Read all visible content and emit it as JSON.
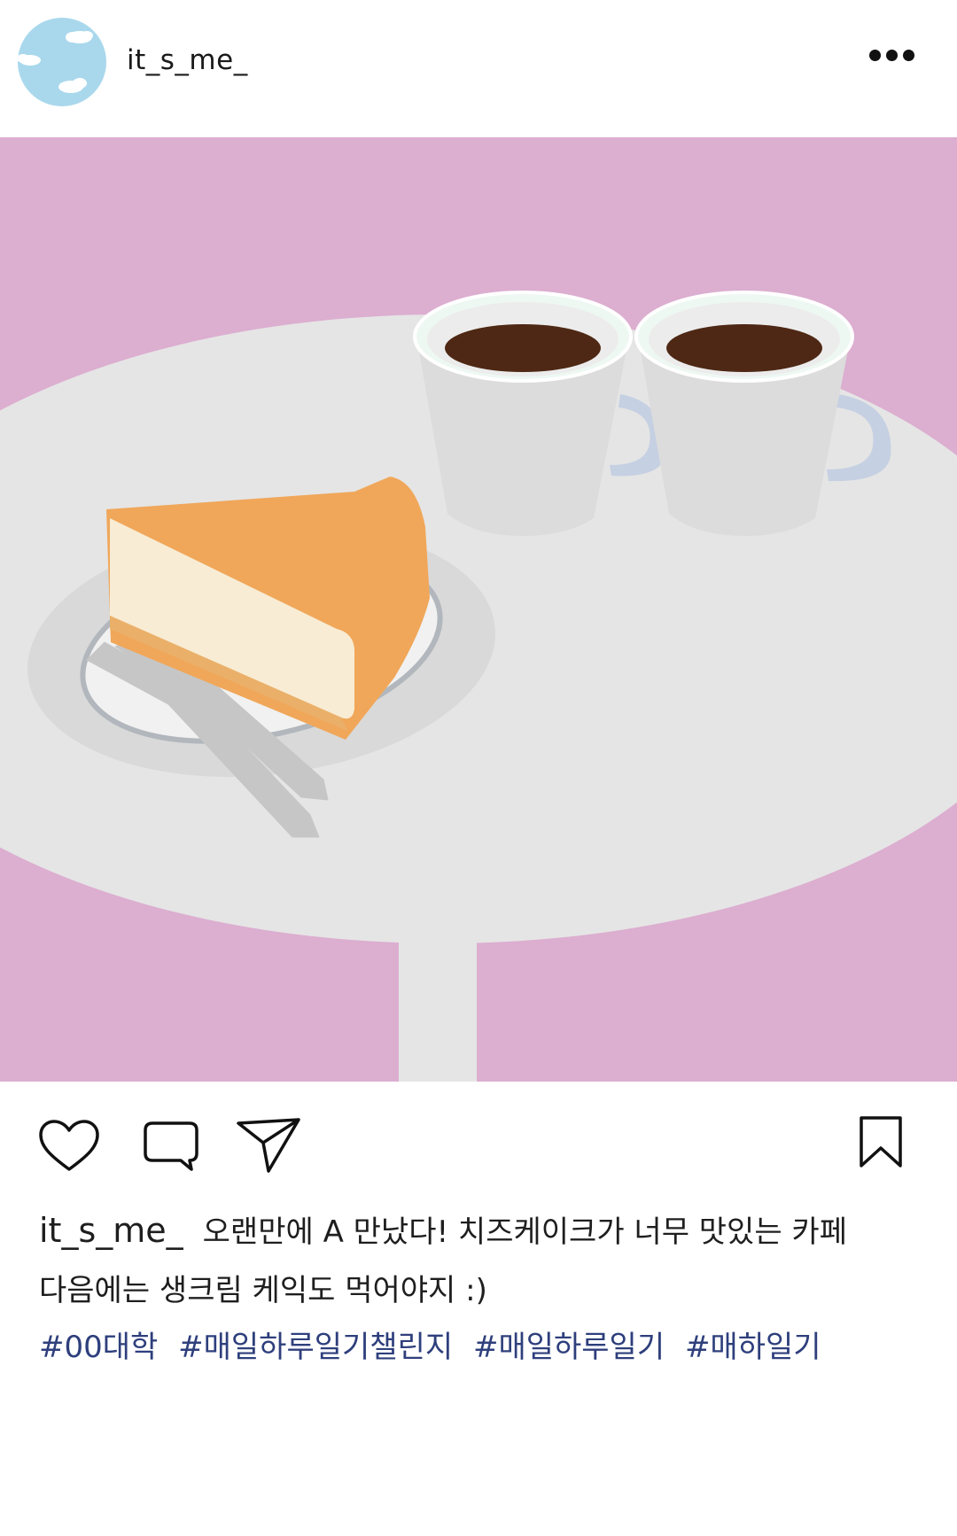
{
  "post": {
    "username": "it_s_me_",
    "caption_username": "it_s_me_",
    "caption_line1": "오랜만에 A 만났다! 치즈케이크가 너무 맛있는 카페",
    "caption_line2": "다음에는 생크림 케익도 먹어야지 :)",
    "hashtags": [
      "#00대학",
      "#매일하루일기챌린지",
      "#매일하루일기",
      "#매하일기"
    ]
  },
  "icons": {
    "avatar": "sky-cloud-avatar",
    "more": "more-dots-icon",
    "like": "heart-icon",
    "comment": "comment-icon",
    "share": "paper-plane-icon",
    "save": "bookmark-icon"
  },
  "colors": {
    "background": "#dcaed0",
    "table": "#e5e5e5",
    "cake_crust": "#f0a75a",
    "cake_filling": "#f8ecd4",
    "coffee": "#4e2814",
    "hashtag": "#2e3f7c"
  }
}
